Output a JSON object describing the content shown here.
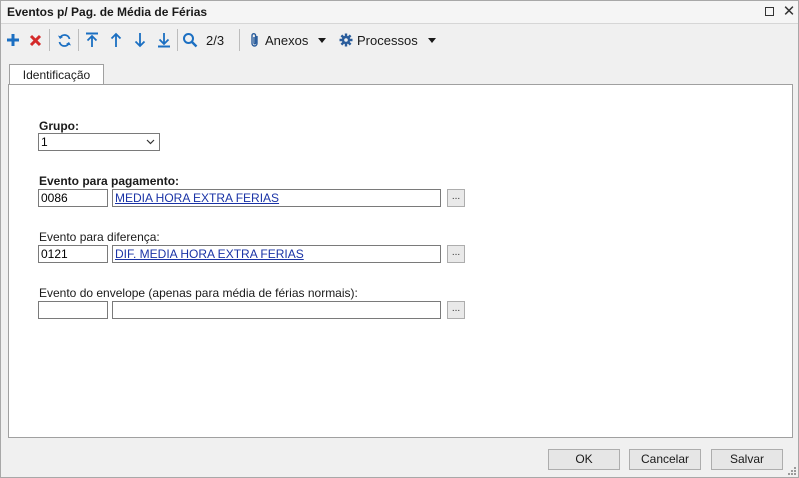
{
  "window": {
    "title": "Eventos p/ Pag. de Média de Férias"
  },
  "toolbar": {
    "record_position": "2/3",
    "attachments_label": "Anexos",
    "processes_label": "Processos",
    "icons": [
      "add-icon",
      "delete-icon",
      "refresh-icon",
      "first-record-icon",
      "previous-record-icon",
      "next-record-icon",
      "last-record-icon",
      "search-icon",
      "paperclip-icon",
      "gear-icon"
    ],
    "colors": {
      "add": "#1b6fc2",
      "delete": "#d42a2a",
      "nav": "#1b6fc2"
    }
  },
  "tabs": [
    {
      "label": "Identificação",
      "active": true
    }
  ],
  "form": {
    "grupo": {
      "label": "Grupo:",
      "value": "1"
    },
    "evento_pagamento": {
      "label": "Evento para pagamento:",
      "code": "0086",
      "description": "MEDIA HORA EXTRA FERIAS"
    },
    "evento_diferenca": {
      "label": "Evento para diferença:",
      "code": "0121",
      "description": "DIF. MEDIA HORA EXTRA FERIAS"
    },
    "evento_envelope": {
      "label": "Evento do envelope (apenas para média de férias normais):",
      "code": "",
      "description": ""
    },
    "lookup_label": "..."
  },
  "buttons": {
    "ok": "OK",
    "cancel": "Cancelar",
    "save": "Salvar"
  }
}
